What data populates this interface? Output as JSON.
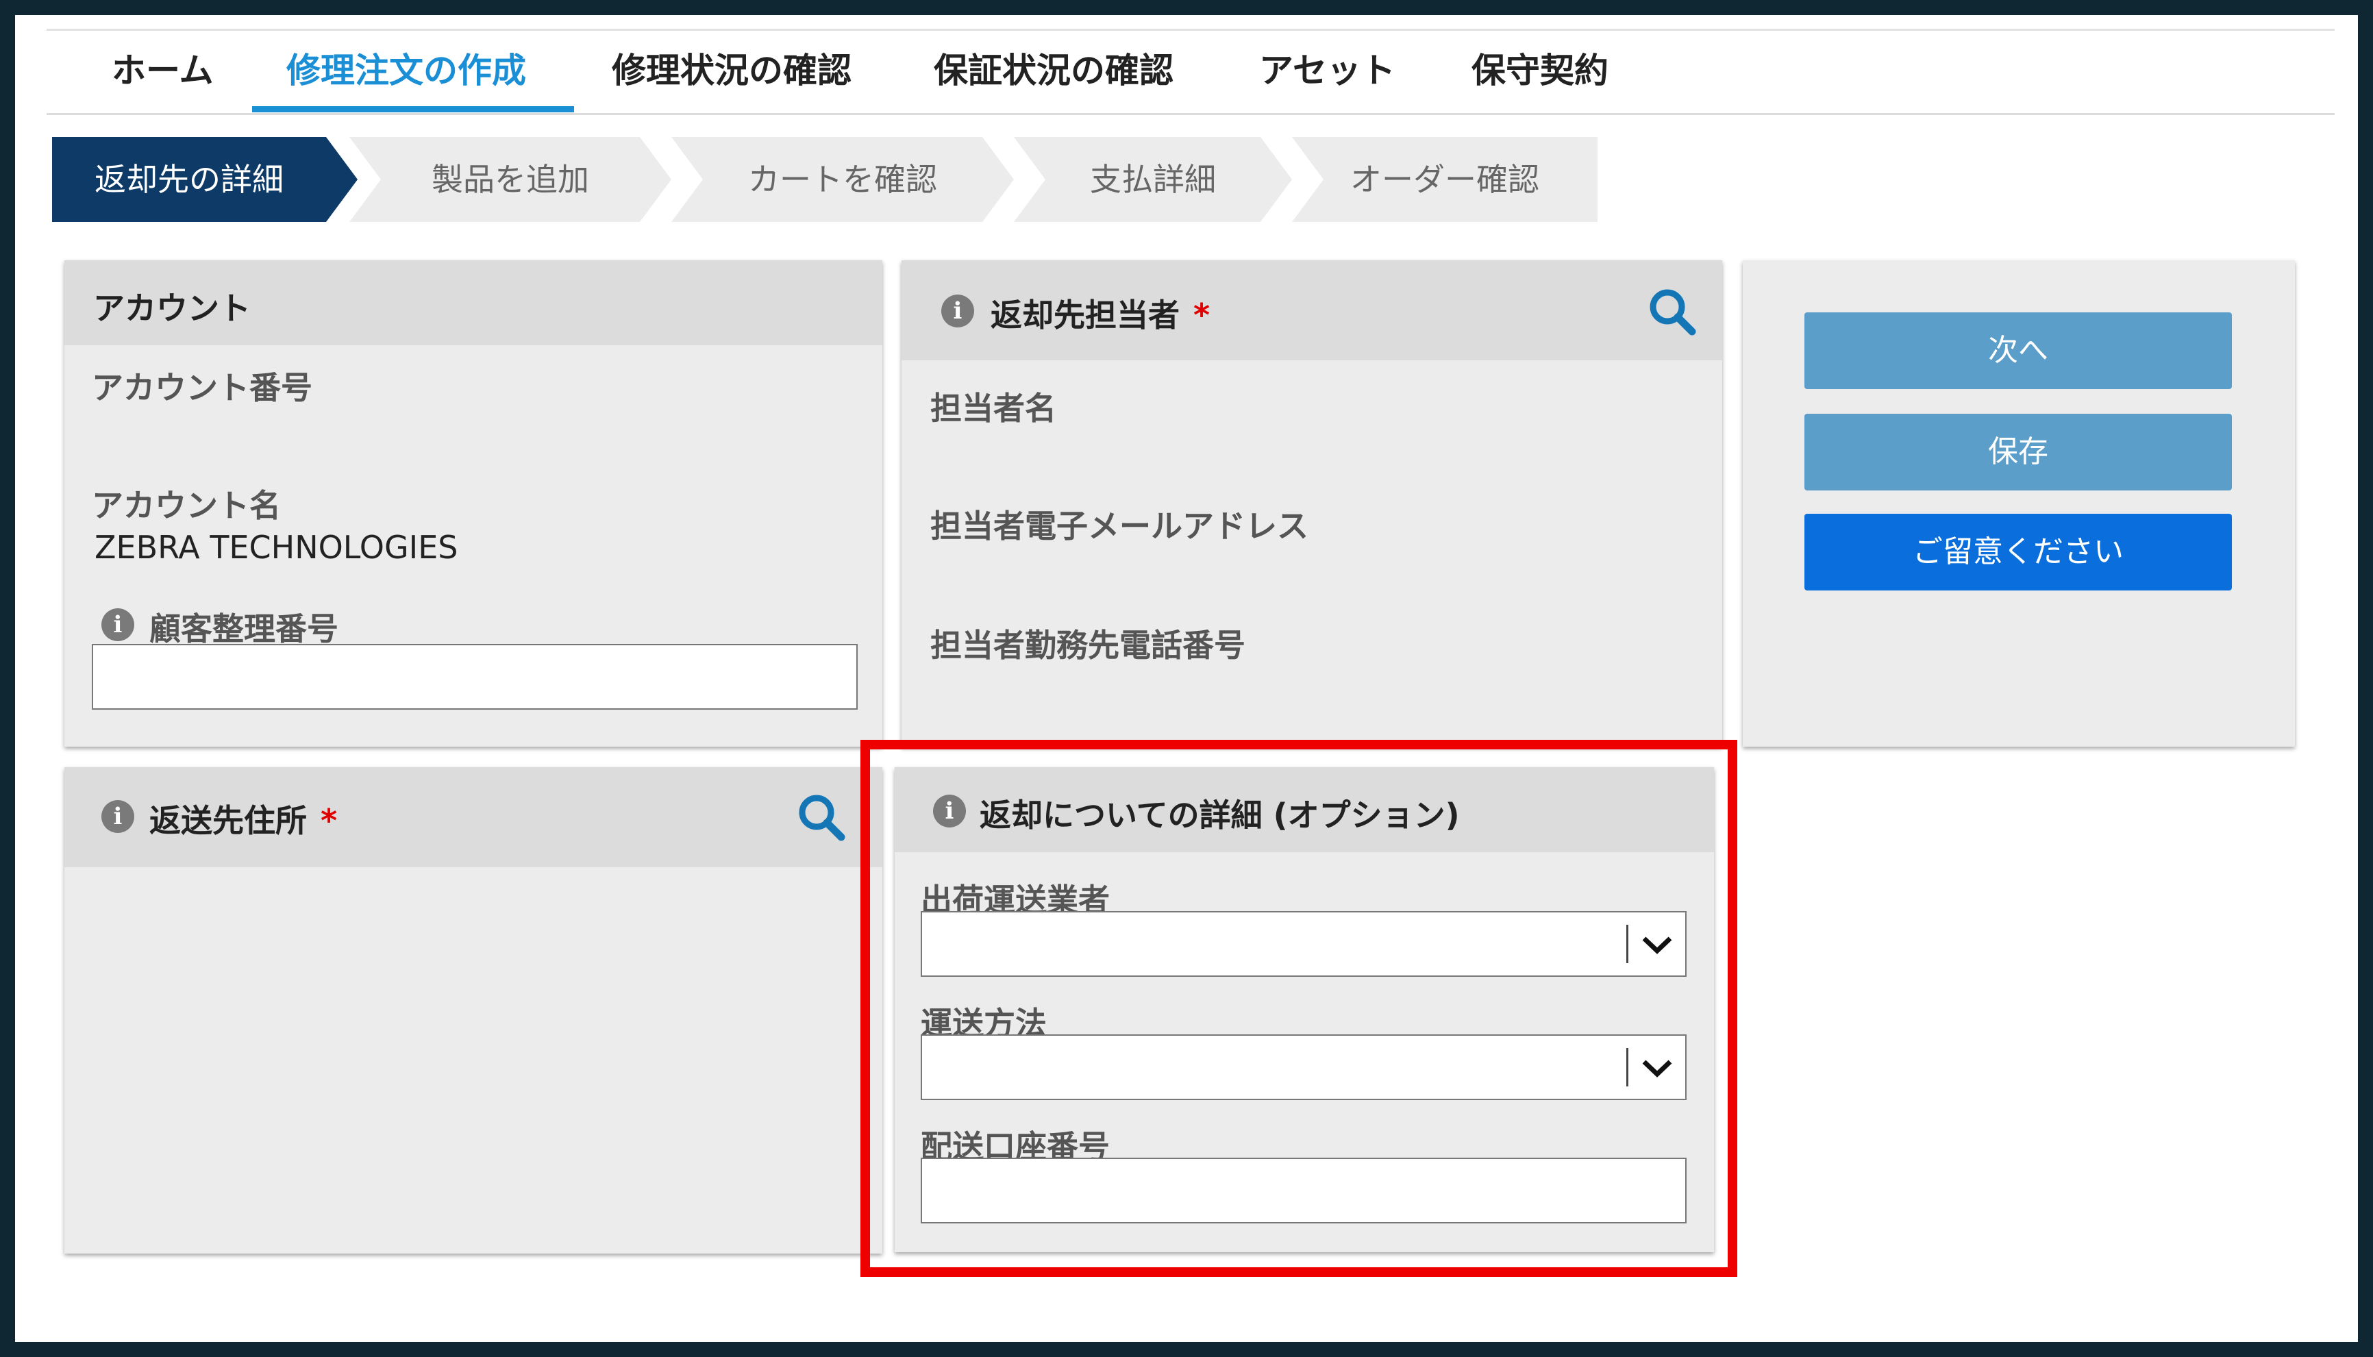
{
  "nav": {
    "items": [
      "ホーム",
      "修理注文の作成",
      "修理状況の確認",
      "保証状況の確認",
      "アセット",
      "保守契約"
    ],
    "active_index": 1
  },
  "stepper": {
    "steps": [
      "返却先の詳細",
      "製品を追加",
      "カートを確認",
      "支払詳細",
      "オーダー確認"
    ],
    "active_index": 0
  },
  "account": {
    "title": "アカウント",
    "number_label": "アカウント番号",
    "number_value": "",
    "name_label": "アカウント名",
    "name_value": "ZEBRA TECHNOLOGIES",
    "ref_label": "顧客整理番号",
    "ref_value": ""
  },
  "contact": {
    "title": "返却先担当者",
    "required_mark": "*",
    "name_label": "担当者名",
    "email_label": "担当者電子メールアドレス",
    "phone_label": "担当者勤務先電話番号"
  },
  "actions": {
    "next_label": "次へ",
    "save_label": "保存",
    "notice_label": "ご留意ください"
  },
  "address": {
    "title": "返送先住所",
    "required_mark": "*"
  },
  "return_details": {
    "title": "返却についての詳細 (オプション)",
    "carrier_label": "出荷運送業者",
    "carrier_value": "",
    "method_label": "運送方法",
    "method_value": "",
    "account_label": "配送口座番号",
    "account_value": ""
  },
  "colors": {
    "brand_blue": "#1b8fd6",
    "step_active": "#0d3a66",
    "button_muted": "#5b9ec9",
    "button_primary": "#0a6fdc",
    "required": "#e00000",
    "highlight": "#ee0000"
  },
  "icons": [
    "info-icon",
    "search-icon",
    "chevron-down-icon"
  ]
}
